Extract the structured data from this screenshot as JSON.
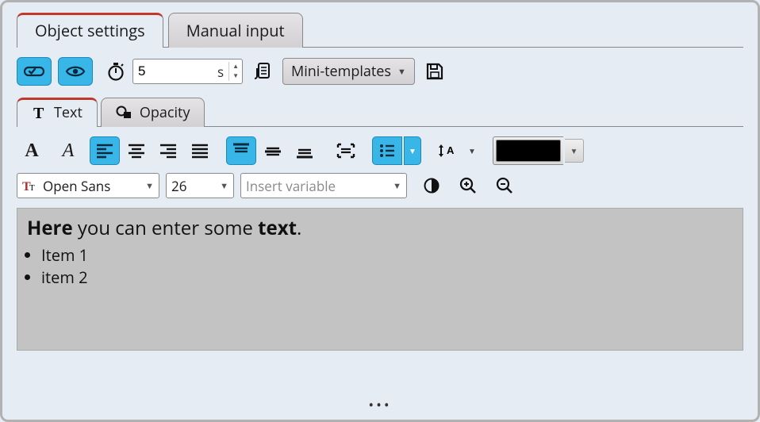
{
  "mainTabs": {
    "objectSettings": "Object settings",
    "manualInput": "Manual input"
  },
  "toolbar": {
    "duration_value": "5",
    "duration_unit": "s",
    "miniTemplates": "Mini-templates"
  },
  "subTabs": {
    "text": "Text",
    "opacity": "Opacity"
  },
  "fontRow": {
    "font": "Open Sans",
    "size": "26",
    "insertVariable": "Insert variable"
  },
  "colors": {
    "textColor": "#000000",
    "accent": "#38b6e8"
  },
  "editor": {
    "boldWord1": "Here",
    "mid": " you can enter some ",
    "boldWord2": "text",
    "tail": ".",
    "bullets": [
      "Item 1",
      "item 2"
    ]
  }
}
